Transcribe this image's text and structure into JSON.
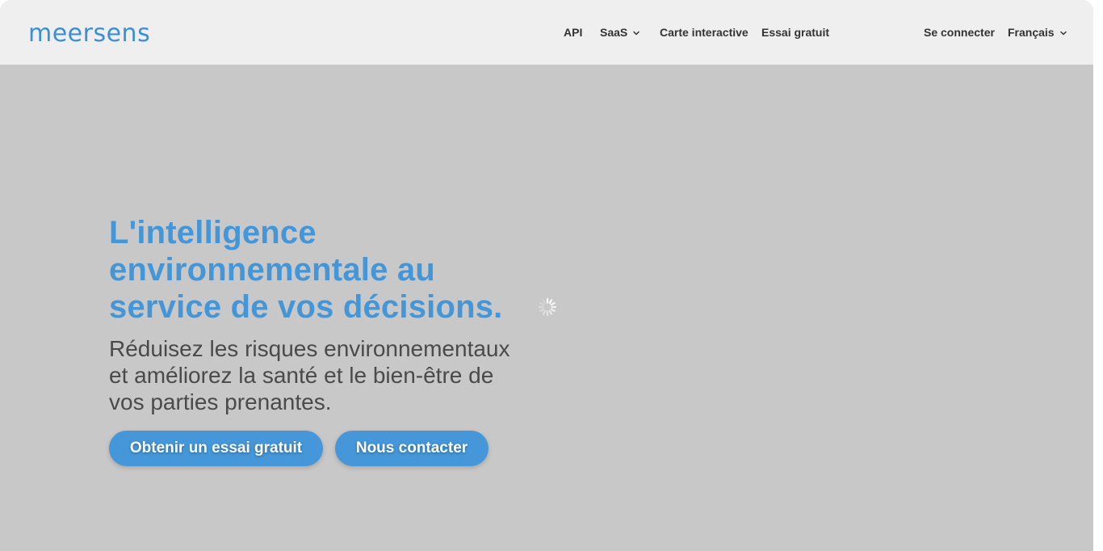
{
  "header": {
    "logo_text": "meersens",
    "nav": [
      {
        "label": "API"
      },
      {
        "label": "SaaS",
        "has_dropdown": true
      },
      {
        "label": "Carte interactive"
      },
      {
        "label": "Essai gratuit"
      }
    ],
    "login_label": "Se connecter",
    "language_label": "Français"
  },
  "hero": {
    "title_line1": "L'intelligence",
    "title_line2": "environnementale au",
    "title_line3": "service de vos décisions.",
    "subtitle_line1": "Réduisez les risques environnementaux",
    "subtitle_line2": "et améliorez la santé et le bien-être de",
    "subtitle_line3": "vos parties prenantes.",
    "cta_primary": "Obtenir un essai gratuit",
    "cta_secondary": "Nous contacter"
  },
  "colors": {
    "brand_blue": "#4396d8",
    "button_blue": "#4597d9",
    "header_bg": "#efefef",
    "page_bg": "#c8c8c8",
    "nav_text": "#333333"
  },
  "icons": {
    "dropdown": "chevron-down-icon",
    "loading": "loading-spinner-icon"
  }
}
